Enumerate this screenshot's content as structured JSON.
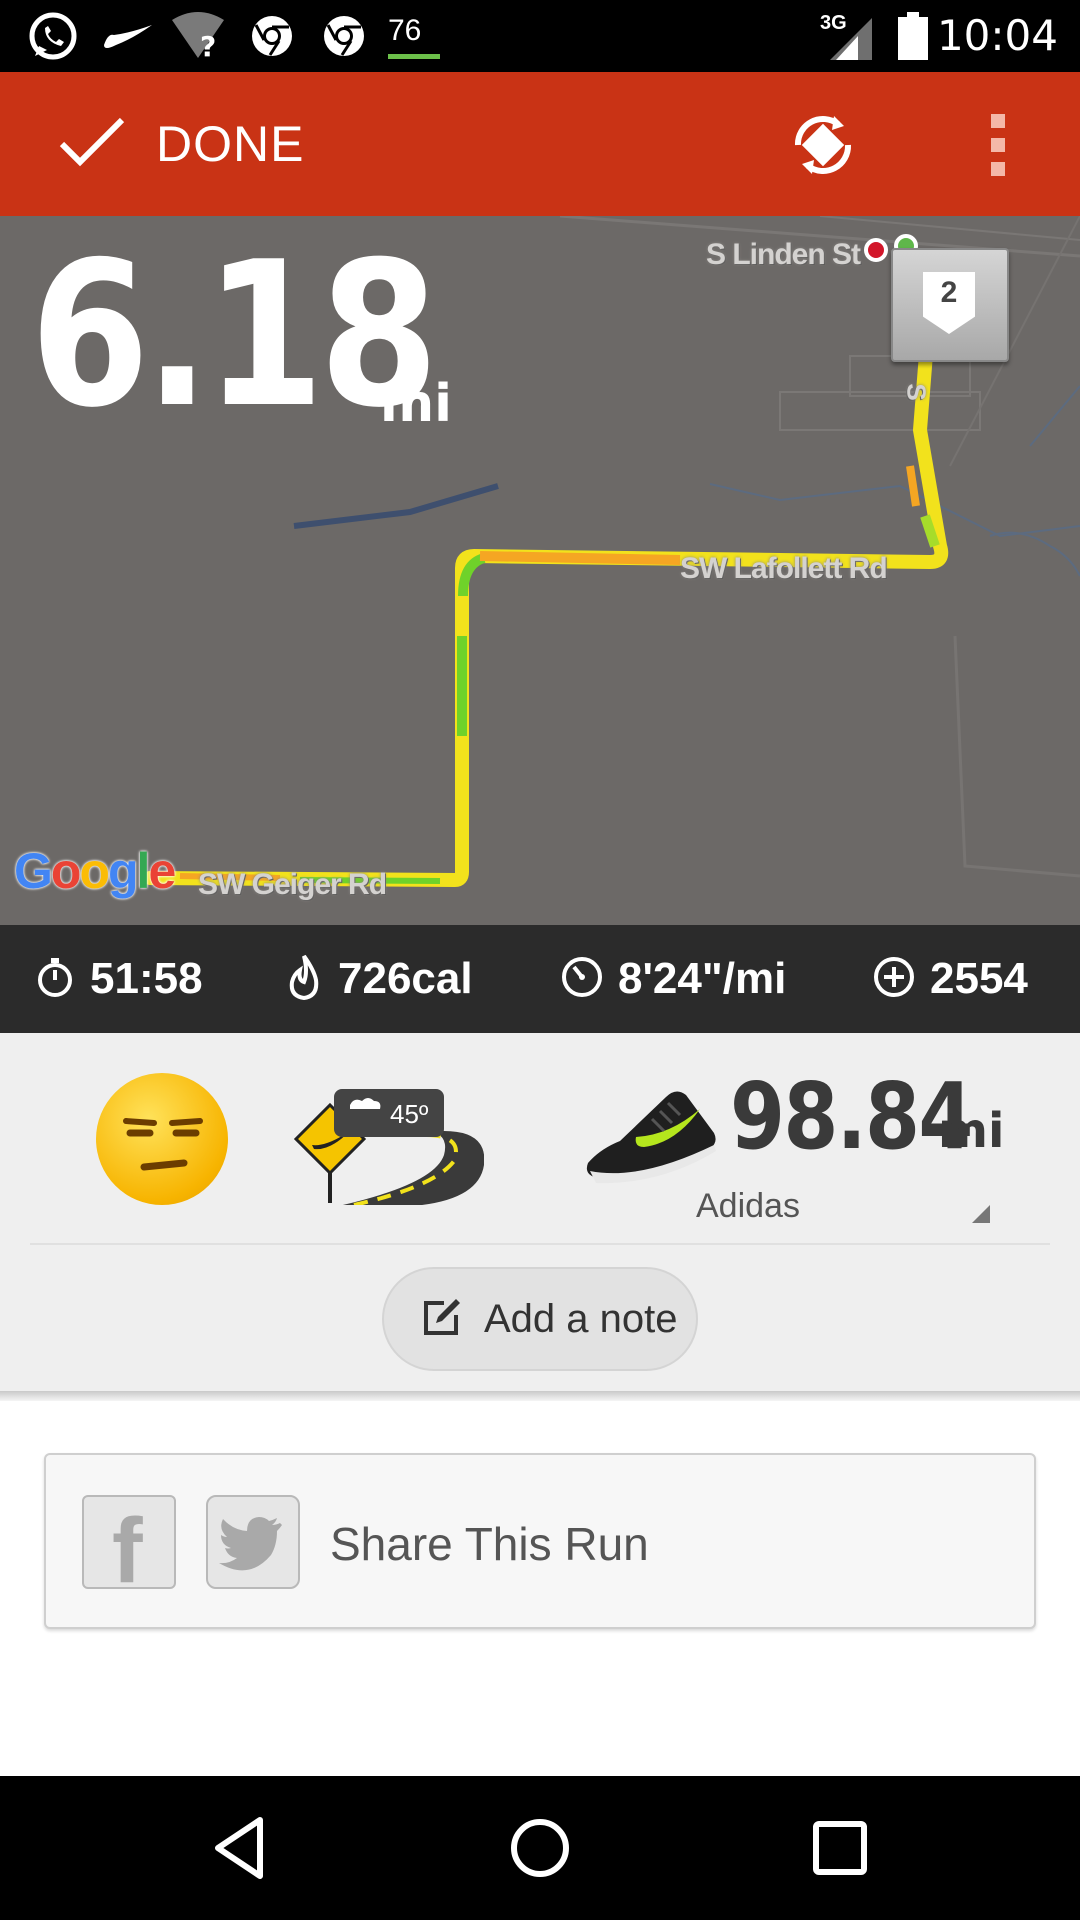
{
  "status_bar": {
    "notification_icons": [
      "whatsapp-icon",
      "nike-swoosh-icon",
      "wifi-question-icon",
      "chrome-icon",
      "chrome-icon"
    ],
    "battery_badge": "76",
    "network_type": "3G",
    "time": "10:04"
  },
  "action_bar": {
    "done_label": "DONE",
    "sync_icon": "sync-icon",
    "overflow_icon": "overflow-menu-icon"
  },
  "map": {
    "distance_value": "6.18",
    "distance_unit": "mi",
    "streets": [
      "S Linden St",
      "SW Lafollett Rd",
      "SW Geiger Rd"
    ],
    "mile_marker": "2",
    "attribution": [
      "G",
      "o",
      "o",
      "g",
      "l",
      "e"
    ],
    "attribution_colors": [
      "#4285f4",
      "#ea4335",
      "#fbbc05",
      "#4285f4",
      "#34a853",
      "#ea4335"
    ]
  },
  "stats": {
    "duration": "51:58",
    "calories": "726cal",
    "pace": "8'24\"/mi",
    "fuel": "2554"
  },
  "details": {
    "mood_icon": "unamused-face-emoji",
    "terrain_icon": "road-terrain-icon",
    "temperature": "45º",
    "shoe_distance": "98.84",
    "shoe_unit": "mi",
    "shoe_name": "Adidas",
    "add_note_label": "Add a note"
  },
  "share": {
    "label": "Share This Run",
    "facebook_glyph": "f"
  },
  "colors": {
    "accent": "#c93315",
    "map_bg": "#6c6967",
    "stats_bg": "#2b2b2b",
    "route_yellow": "#f2e21c",
    "route_green": "#6fd22a",
    "route_orange": "#f5a623"
  }
}
